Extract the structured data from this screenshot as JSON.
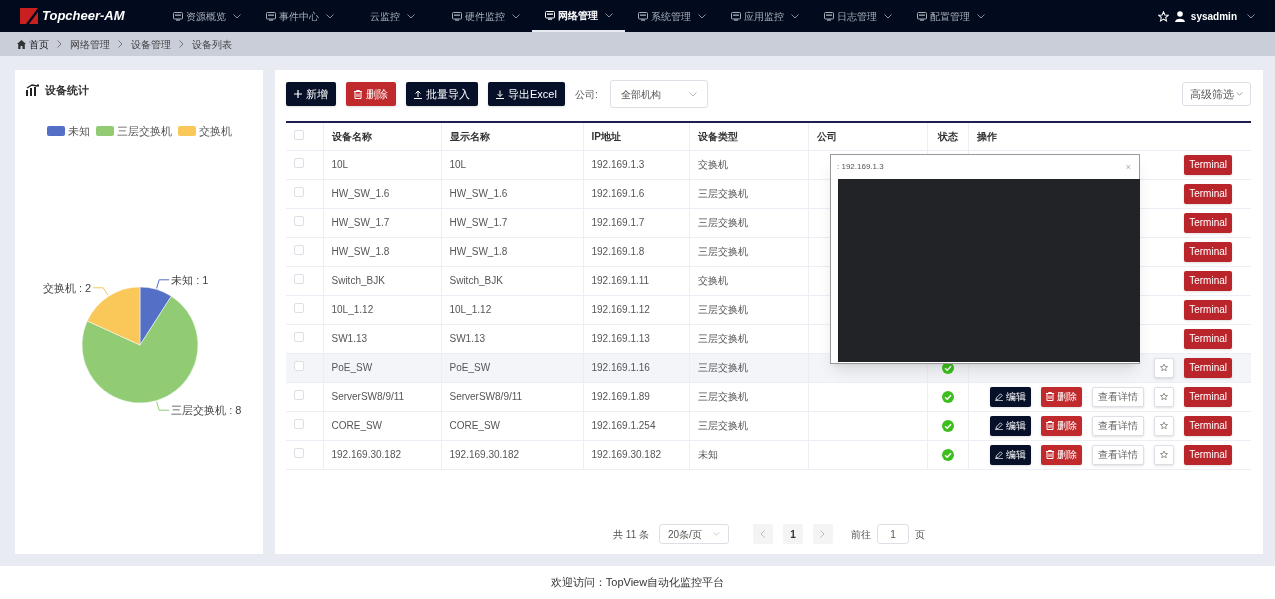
{
  "nav": {
    "logo": "Topcheer-AM",
    "items": [
      {
        "label": "资源概览",
        "icon": true,
        "selected": false
      },
      {
        "label": "事件中心",
        "icon": true,
        "selected": false
      },
      {
        "label": "云监控",
        "icon": false,
        "selected": false
      },
      {
        "label": "硬件监控",
        "icon": true,
        "selected": false
      },
      {
        "label": "网络管理",
        "icon": true,
        "selected": true
      },
      {
        "label": "系统管理",
        "icon": true,
        "selected": false
      },
      {
        "label": "应用监控",
        "icon": true,
        "selected": false
      },
      {
        "label": "日志管理",
        "icon": true,
        "selected": false
      },
      {
        "label": "配置管理",
        "icon": true,
        "selected": false
      }
    ],
    "user": "sysadmin"
  },
  "breadcrumb": [
    "首页",
    "网络管理",
    "设备管理",
    "设备列表"
  ],
  "stats": {
    "title": "设备统计",
    "chart_data": {
      "type": "pie",
      "categories": [
        "未知",
        "三层交换机",
        "交换机"
      ],
      "values": [
        1,
        8,
        2
      ],
      "colors": [
        "#5470c6",
        "#91cc75",
        "#fac858"
      ],
      "value_labels": [
        "未知 : 1",
        "三层交换机 : 8",
        "交换机 : 2"
      ]
    }
  },
  "toolbar": {
    "buttons": [
      {
        "label": "新增",
        "kind": "add"
      },
      {
        "label": "删除",
        "kind": "delete"
      },
      {
        "label": "批量导入",
        "kind": "import"
      },
      {
        "label": "导出Excel",
        "kind": "export"
      }
    ],
    "company_label": "公司:",
    "company_value": "全部机构",
    "filter": "高级筛选"
  },
  "table": {
    "header_checked": false,
    "columns": [
      "设备名称",
      "显示名称",
      "IP地址",
      "设备类型",
      "公司",
      "状态",
      "操作"
    ],
    "rows": [
      {
        "name": "10L",
        "display": "10L",
        "ip": "192.169.1.3",
        "type": "交换机",
        "checked": false,
        "highlighted": false,
        "actions": [
          {
            "kind": "terminal",
            "label": "Terminal"
          }
        ]
      },
      {
        "name": "HW_SW_1.6",
        "display": "HW_SW_1.6",
        "ip": "192.169.1.6",
        "type": "三层交换机",
        "checked": false,
        "highlighted": false,
        "actions": [
          {
            "kind": "terminal",
            "label": "Terminal"
          }
        ]
      },
      {
        "name": "HW_SW_1.7",
        "display": "HW_SW_1.7",
        "ip": "192.169.1.7",
        "type": "三层交换机",
        "checked": false,
        "highlighted": false,
        "actions": [
          {
            "kind": "terminal",
            "label": "Terminal"
          }
        ]
      },
      {
        "name": "HW_SW_1.8",
        "display": "HW_SW_1.8",
        "ip": "192.169.1.8",
        "type": "三层交换机",
        "checked": false,
        "highlighted": false,
        "actions": [
          {
            "kind": "terminal",
            "label": "Terminal"
          }
        ]
      },
      {
        "name": "Switch_BJK",
        "display": "Switch_BJK",
        "ip": "192.169.1.11",
        "type": "交换机",
        "checked": false,
        "highlighted": false,
        "actions": [
          {
            "kind": "terminal",
            "label": "Terminal"
          }
        ]
      },
      {
        "name": "10L_1.12",
        "display": "10L_1.12",
        "ip": "192.169.1.12",
        "type": "三层交换机",
        "checked": false,
        "highlighted": false,
        "actions": [
          {
            "kind": "terminal",
            "label": "Terminal"
          }
        ]
      },
      {
        "name": "SW1.13",
        "display": "SW1.13",
        "ip": "192.169.1.13",
        "type": "三层交换机",
        "checked": false,
        "highlighted": false,
        "actions": [
          {
            "kind": "terminal",
            "label": "Terminal"
          }
        ]
      },
      {
        "name": "PoE_SW",
        "display": "PoE_SW",
        "ip": "192.169.1.16",
        "type": "三层交换机",
        "checked": false,
        "highlighted": true,
        "online": true,
        "actions": [
          {
            "kind": "star"
          },
          {
            "kind": "terminal",
            "label": "Terminal"
          }
        ]
      },
      {
        "name": "ServerSW8/9/11",
        "display": "ServerSW8/9/11",
        "ip": "192.169.1.89",
        "type": "三层交换机",
        "checked": false,
        "highlighted": false,
        "online": true,
        "actions": [
          {
            "kind": "edit",
            "label": "编辑"
          },
          {
            "kind": "delete",
            "label": "删除"
          },
          {
            "kind": "detail",
            "label": "查看详情"
          },
          {
            "kind": "star"
          },
          {
            "kind": "terminal",
            "label": "Terminal"
          }
        ]
      },
      {
        "name": "CORE_SW",
        "display": "CORE_SW",
        "ip": "192.169.1.254",
        "type": "三层交换机",
        "checked": false,
        "highlighted": false,
        "online": true,
        "actions": [
          {
            "kind": "edit",
            "label": "编辑"
          },
          {
            "kind": "delete",
            "label": "删除"
          },
          {
            "kind": "detail",
            "label": "查看详情"
          },
          {
            "kind": "star"
          },
          {
            "kind": "terminal",
            "label": "Terminal"
          }
        ]
      },
      {
        "name": "192.169.30.182",
        "display": "192.169.30.182",
        "ip": "192.169.30.182",
        "type": "未知",
        "checked": false,
        "highlighted": false,
        "online": true,
        "actions": [
          {
            "kind": "edit",
            "label": "编辑"
          },
          {
            "kind": "delete",
            "label": "删除"
          },
          {
            "kind": "detail",
            "label": "查看详情"
          },
          {
            "kind": "star"
          },
          {
            "kind": "terminal",
            "label": "Terminal"
          }
        ]
      }
    ]
  },
  "pagination": {
    "total": "共 11 条",
    "page_size": "20条/页",
    "page": "1",
    "goto_label": "前往",
    "goto_value": "1",
    "goto_suffix": "页"
  },
  "terminal_popup": {
    "title": ": 192.169.1.3",
    "close": "×"
  },
  "footer": "欢迎访问：TopView自动化监控平台"
}
